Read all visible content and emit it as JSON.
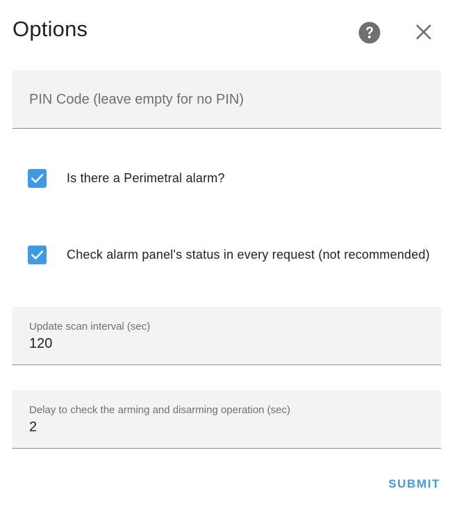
{
  "dialog": {
    "title": "Options",
    "help_icon": "help-circle-icon",
    "close_icon": "close-icon"
  },
  "fields": {
    "pin": {
      "placeholder": "PIN Code (leave empty for no PIN)",
      "value": ""
    },
    "perimetral": {
      "label": "Is there a Perimetral alarm?",
      "checked": true
    },
    "check_status": {
      "label": "Check alarm panel's status in every request (not recommended)",
      "checked": true
    },
    "scan_interval": {
      "label": "Update scan interval (sec)",
      "value": "120"
    },
    "delay_check": {
      "label": "Delay to check the arming and disarming operation (sec)",
      "value": "2"
    }
  },
  "actions": {
    "submit_label": "SUBMIT"
  },
  "colors": {
    "accent": "#3f9ae6",
    "field_bg": "#f3f3f3",
    "icon_gray": "#707070"
  }
}
